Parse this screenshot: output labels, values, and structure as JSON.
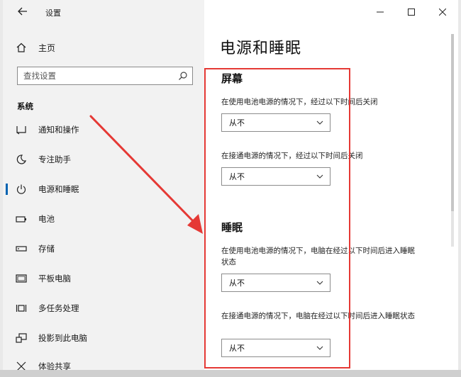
{
  "window": {
    "title": "设置",
    "controls": {
      "minimize": "minimize-icon",
      "maximize": "maximize-icon",
      "close": "close-icon"
    }
  },
  "sidebar": {
    "home_label": "主页",
    "search_placeholder": "查找设置",
    "section_label": "系统",
    "items": [
      {
        "label": "通知和操作",
        "icon": "notification-icon",
        "active": false
      },
      {
        "label": "专注助手",
        "icon": "moon-icon",
        "active": false
      },
      {
        "label": "电源和睡眠",
        "icon": "power-icon",
        "active": true
      },
      {
        "label": "电池",
        "icon": "battery-icon",
        "active": false
      },
      {
        "label": "存储",
        "icon": "storage-icon",
        "active": false
      },
      {
        "label": "平板电脑",
        "icon": "tablet-icon",
        "active": false
      },
      {
        "label": "多任务处理",
        "icon": "multitask-icon",
        "active": false
      },
      {
        "label": "投影到此电脑",
        "icon": "project-icon",
        "active": false
      },
      {
        "label": "体验共享",
        "icon": "share-icon",
        "active": false
      }
    ]
  },
  "content": {
    "page_title": "电源和睡眠",
    "screen": {
      "title": "屏幕",
      "battery_desc": "在使用电池电源的情况下，经过以下时间后关闭",
      "battery_value": "从不",
      "plugged_desc": "在接通电源的情况下，经过以下时间后关闭",
      "plugged_value": "从不"
    },
    "sleep": {
      "title": "睡眠",
      "battery_desc": "在使用电池电源的情况下，电脑在经过以下时间后进入睡眠状态",
      "battery_value": "从不",
      "plugged_desc": "在接通电源的情况下，电脑在经过以下时间后进入睡眠状态",
      "plugged_value": "从不"
    }
  },
  "annotation": {
    "color": "#e53935"
  },
  "accent_color": "#0063b1"
}
